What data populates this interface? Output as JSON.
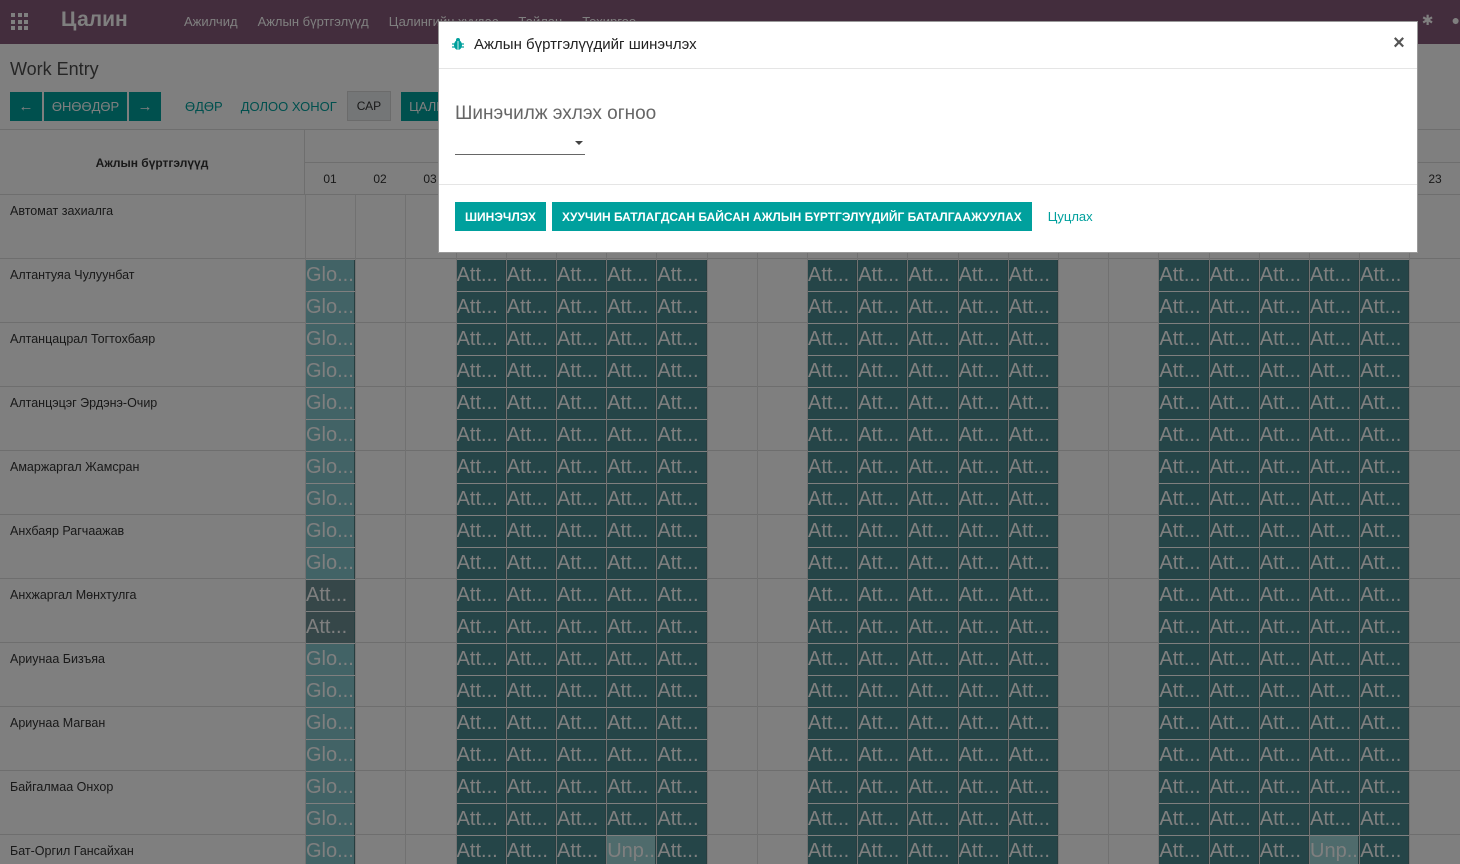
{
  "navbar": {
    "brand": "Цалин",
    "menu": [
      "Ажилчид",
      "Ажлын бүртгэлүүд",
      "Цалингийн хуудас",
      "Тайлан",
      "Тохиргоо"
    ],
    "icons": [
      "apps-grid-icon",
      "bug-icon",
      "chat-icon"
    ]
  },
  "control_panel": {
    "breadcrumb": "Work Entry",
    "prev_label": "←",
    "today_label": "ӨНӨӨДӨР",
    "next_label": "→",
    "scales": [
      "ӨДӨР",
      "ДОЛОО ХОНОГ",
      "САР"
    ],
    "active_scale": "САР",
    "payslip_button": "ЦАЛИ"
  },
  "gantt": {
    "title": "Ажлын бүртгэлүүд",
    "days": [
      "01",
      "02",
      "03",
      "23"
    ],
    "rows": [
      {
        "name": "Автомат захиалга"
      },
      {
        "name": "Алтантуяа Чулуунбат"
      },
      {
        "name": "Алтанцацрал Тогтохбаяр"
      },
      {
        "name": "Алтанцэцэг Эрдэнэ-Очир"
      },
      {
        "name": "Амаржаргал Жамсран"
      },
      {
        "name": "Анхбаяр Рагчаажав"
      },
      {
        "name": "Анхжаргал Мөнхтулга"
      },
      {
        "name": "Ариунаа Бизъяа"
      },
      {
        "name": "Ариунаа Магван"
      },
      {
        "name": "Байгалмаа Онхор"
      },
      {
        "name": "Бат-Оргил Гансайхан"
      }
    ],
    "pill_labels": {
      "glo": "Glo...",
      "att": "Att...",
      "unp": "Unp..."
    }
  },
  "modal": {
    "title": "Ажлын бүртгэлүүдийг шинэчлэх",
    "close": "×",
    "field_label": "Шинэчилж эхлэх огноо",
    "date_value": "",
    "btn_update": "ШИНЭЧЛЭХ",
    "btn_validate": "ХУУЧИН БАТЛАГДСАН БАЙСАН АЖЛЫН БҮРТГЭЛҮҮДИЙГ БАТАЛГААЖУУЛАХ",
    "btn_cancel": "Цуцлах"
  }
}
